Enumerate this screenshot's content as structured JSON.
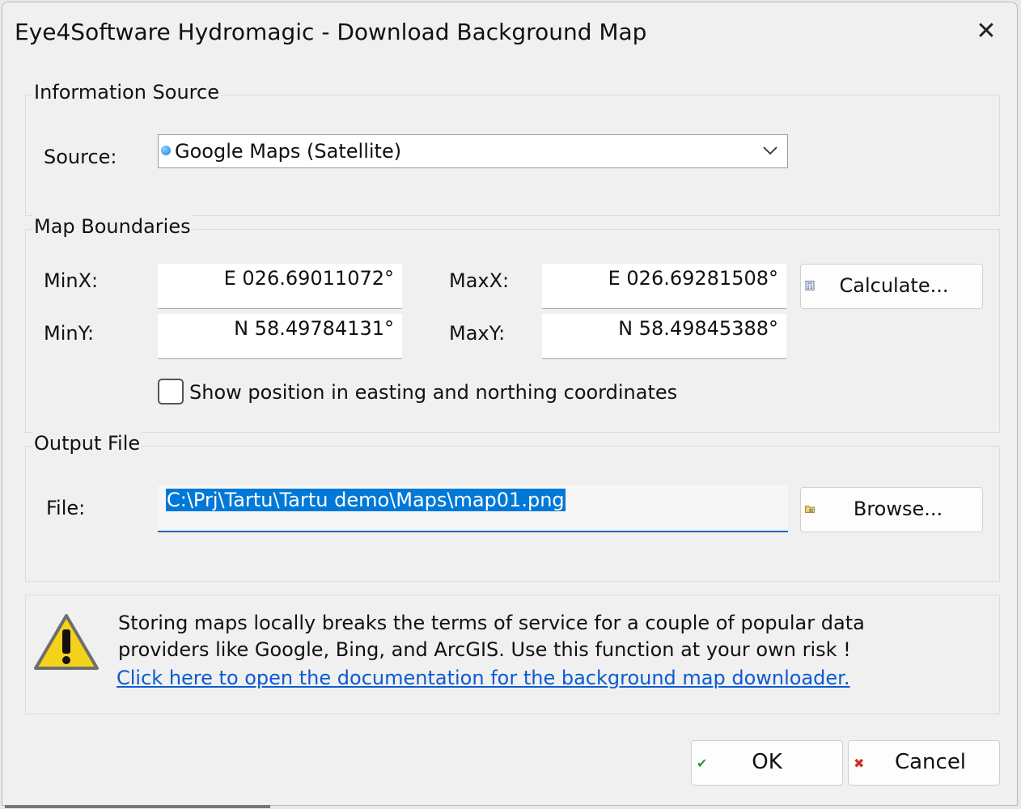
{
  "window": {
    "title": "Eye4Software Hydromagic - Download Background Map",
    "close_symbol": "✕"
  },
  "information_source": {
    "group_title": "Information Source",
    "source_label": "Source:",
    "source_value": "Google Maps (Satellite)",
    "source_icon": "globe-icon"
  },
  "map_boundaries": {
    "group_title": "Map Boundaries",
    "minx_label": "MinX:",
    "minx_value": "E 026.69011072°",
    "maxx_label": "MaxX:",
    "maxx_value": "E 026.69281508°",
    "miny_label": "MinY:",
    "miny_value": "N 58.49784131°",
    "maxy_label": "MaxY:",
    "maxy_value": "N 58.49845388°",
    "calculate_label": "Calculate...",
    "calculate_icon": "calculator-icon",
    "checkbox_label": "Show position in easting and northing coordinates",
    "checkbox_checked": false
  },
  "output_file": {
    "group_title": "Output File",
    "file_label": "File:",
    "file_value": "C:\\Prj\\Tartu\\Tartu demo\\Maps\\map01.png",
    "browse_label": "Browse...",
    "browse_icon": "folder-icon"
  },
  "warning": {
    "line1": "Storing maps locally breaks the terms of service for a couple of popular data",
    "line2": "providers like Google, Bing, and ArcGIS. Use this function at your own risk !",
    "link_text": "Click here to open the documentation for the background map downloader.",
    "icon": "warning-icon"
  },
  "footer": {
    "ok_label": "OK",
    "ok_icon_glyph": "✔",
    "cancel_label": "Cancel",
    "cancel_icon_glyph": "✖"
  },
  "colors": {
    "selection": "#0078d7",
    "link": "#0a5bd1",
    "ok_icon": "#2e9b2e",
    "cancel_icon": "#d42a2a"
  }
}
